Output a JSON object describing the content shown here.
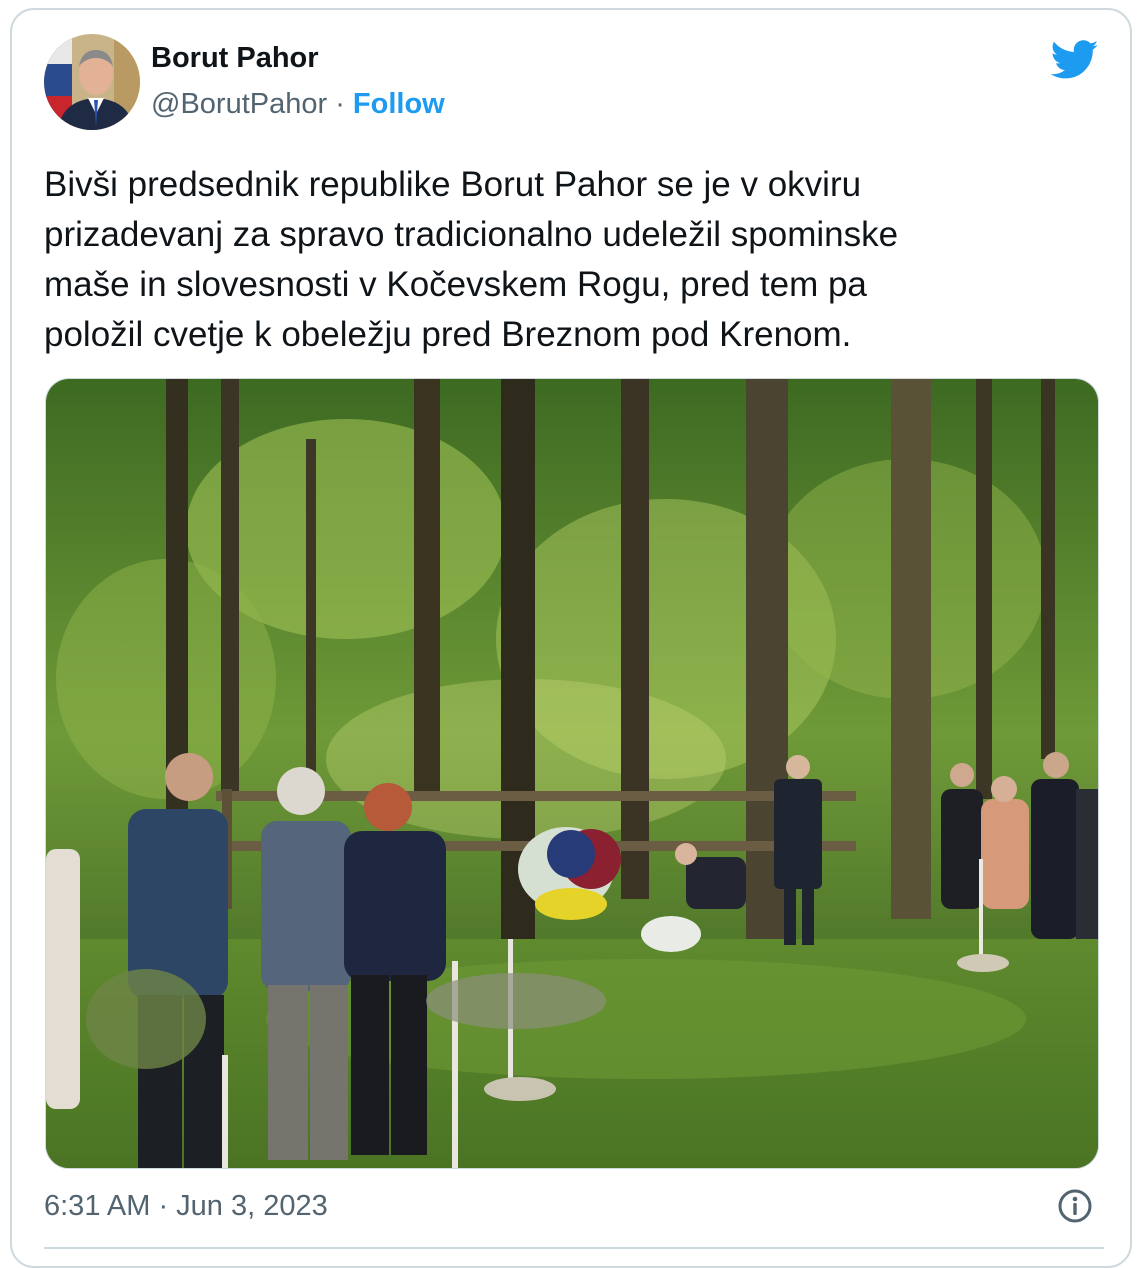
{
  "tweet": {
    "author_name": "Borut Pahor",
    "handle": "@BorutPahor",
    "separator": " · ",
    "follow_label": "Follow",
    "text": "Bivši predsednik republike Borut Pahor se je v okviru\nprizadevanj za spravo tradicionalno udeležil spominske\nmaše in slovesnosti v Kočevskem Rogu, pred tem pa\npoložil cvetje k obeležju pred Breznom pod Krenom.",
    "timestamp": "6:31 AM · Jun 3, 2023"
  },
  "icons": {
    "platform_logo": "bird-logo-icon",
    "info": "info-icon"
  },
  "colors": {
    "accent": "#1d9bf0",
    "text_primary": "#0f1419",
    "text_secondary": "#536471",
    "border": "#cfd9de"
  }
}
